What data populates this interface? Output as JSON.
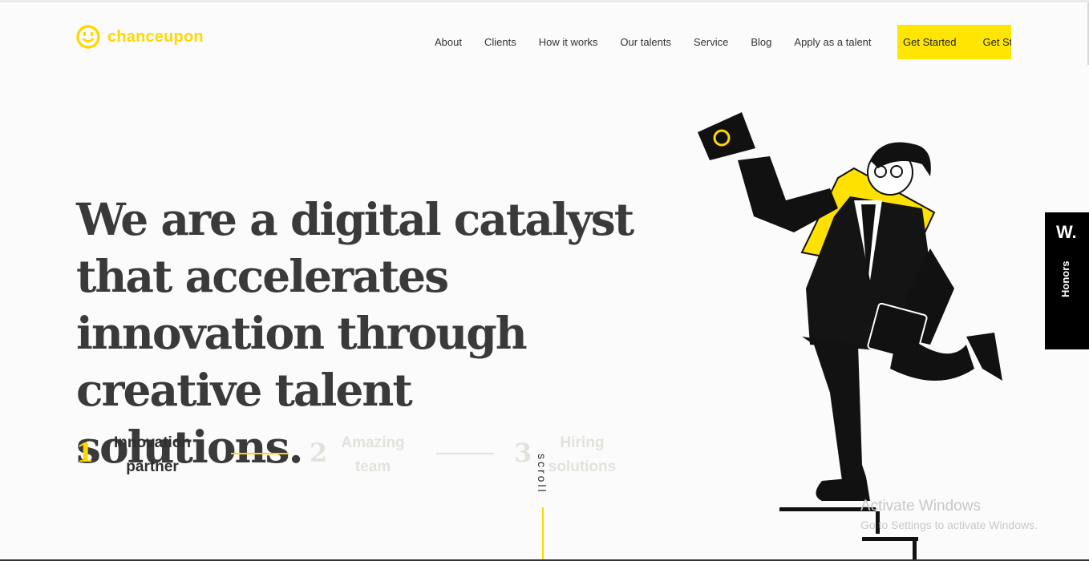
{
  "brand": {
    "name": "chanceupon",
    "accent_color": "#ffd800",
    "cta_color": "#ffe600"
  },
  "nav": {
    "items": [
      "About",
      "Clients",
      "How it works",
      "Our talents",
      "Service",
      "Blog",
      "Apply as a talent"
    ],
    "cta_label": "Get Started",
    "cta_label_ticker": "Get Started"
  },
  "hero": {
    "headline": "We are a digital catalyst that accelerates innovation through creative talent solutions."
  },
  "steps": [
    {
      "num": "1",
      "label": "Innovation partner",
      "active": true
    },
    {
      "num": "2",
      "label": "Amazing team",
      "active": false
    },
    {
      "num": "3",
      "label": "Hiring solutions",
      "active": false
    }
  ],
  "scroll": {
    "label": "scroll"
  },
  "honors": {
    "logo": "W.",
    "label": "Honors"
  },
  "illustration": {
    "icon": "man-carrying-book-icon"
  },
  "watermark": {
    "title": "Activate Windows",
    "subtitle": "Go to Settings to activate Windows."
  }
}
